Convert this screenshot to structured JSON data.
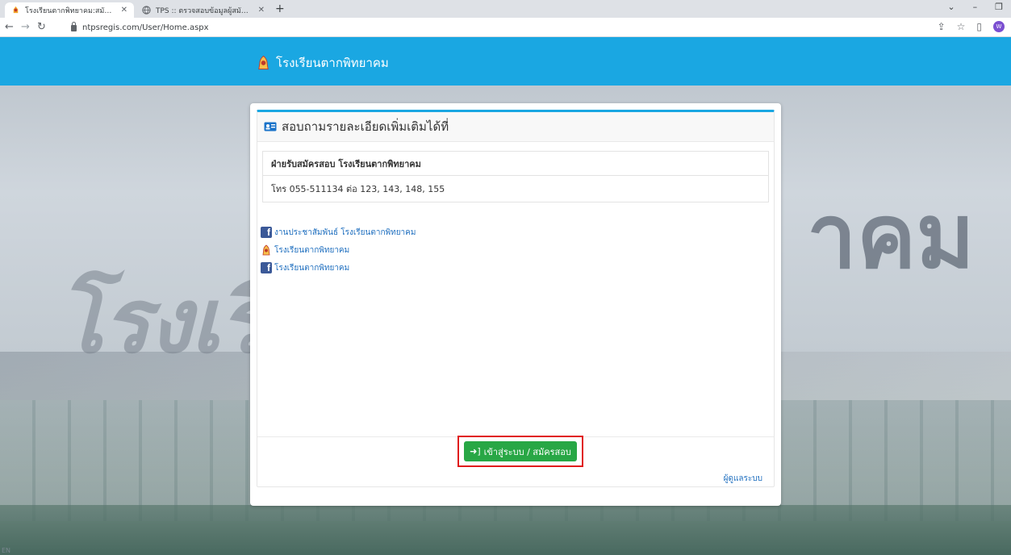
{
  "browser": {
    "tabs": [
      {
        "label": "โรงเรียนตากพิทยาคม:สมัครสอบเข้าเรี",
        "active": true
      },
      {
        "label": "TPS :: ตรวจสอบข้อมูลผู้สมัครสอบเข้าช",
        "active": false
      }
    ],
    "new_tab": "+",
    "url": "ntpsregis.com/User/Home.aspx",
    "avatar_letter": "W"
  },
  "header": {
    "brand": "โรงเรียนตากพิทยาคม"
  },
  "panel": {
    "title": "สอบถามรายละเอียดเพิ่มเติมได้ที่",
    "department": "ฝ่ายรับสมัครสอบ โรงเรียนตากพิทยาคม",
    "telephone": "โทร 055-511134 ต่อ 123, 143, 148, 155",
    "links": [
      {
        "label": "งานประชาสัมพันธ์ โรงเรียนตากพิทยาคม",
        "icon": "facebook-icon"
      },
      {
        "label": "โรงเรียนตากพิทยาคม",
        "icon": "school-logo-icon"
      },
      {
        "label": "โรงเรียนตากพิทยาคม",
        "icon": "facebook-icon"
      }
    ],
    "login_button": "เข้าสู่ระบบ / สมัครสอบ",
    "admin_link": "ผู้ดูแลระบบ"
  },
  "background": {
    "text_left": "โรงเรีย",
    "text_right": "าคม"
  },
  "footer": {
    "lang": "EN"
  },
  "colors": {
    "header": "#1aa7e2",
    "button": "#28a745",
    "highlight": "#e01b1b",
    "link": "#1f6fbf"
  }
}
